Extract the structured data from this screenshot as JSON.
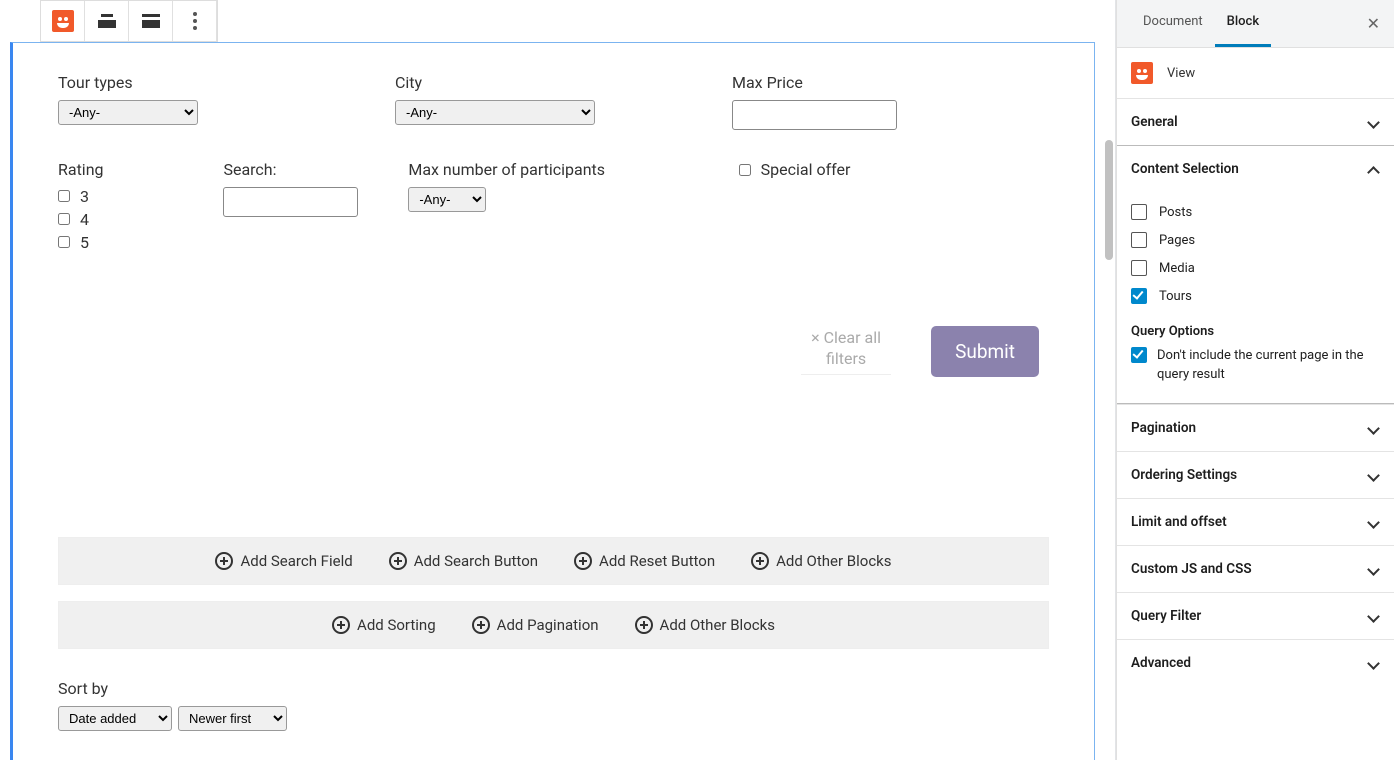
{
  "toolbar": {},
  "filters": {
    "tour_types": {
      "label": "Tour types",
      "value": "-Any-"
    },
    "city": {
      "label": "City",
      "value": "-Any-"
    },
    "max_price": {
      "label": "Max Price",
      "value": ""
    },
    "rating": {
      "label": "Rating",
      "opts": [
        "3",
        "4",
        "5"
      ]
    },
    "search": {
      "label": "Search:",
      "value": ""
    },
    "max_participants": {
      "label": "Max number of participants",
      "value": "-Any-"
    },
    "special_offer": {
      "label": "Special offer"
    },
    "clear": "Clear all filters",
    "submit": "Submit"
  },
  "addbar1": [
    "Add Search Field",
    "Add Search Button",
    "Add Reset Button",
    "Add Other Blocks"
  ],
  "addbar2": [
    "Add Sorting",
    "Add Pagination",
    "Add Other Blocks"
  ],
  "sort": {
    "label": "Sort by",
    "field": "Date added",
    "dir": "Newer first"
  },
  "sidebar": {
    "tabs": {
      "document": "Document",
      "block": "Block"
    },
    "block_name": "View",
    "panels": {
      "general": "General",
      "content_selection": "Content Selection",
      "pagination": "Pagination",
      "ordering": "Ordering Settings",
      "limit": "Limit and offset",
      "jscss": "Custom JS and CSS",
      "query_filter": "Query Filter",
      "advanced": "Advanced"
    },
    "content_types": {
      "posts": "Posts",
      "pages": "Pages",
      "media": "Media",
      "tours": "Tours"
    },
    "query_options_title": "Query Options",
    "exclude_current": "Don't include the current page in the query result"
  }
}
